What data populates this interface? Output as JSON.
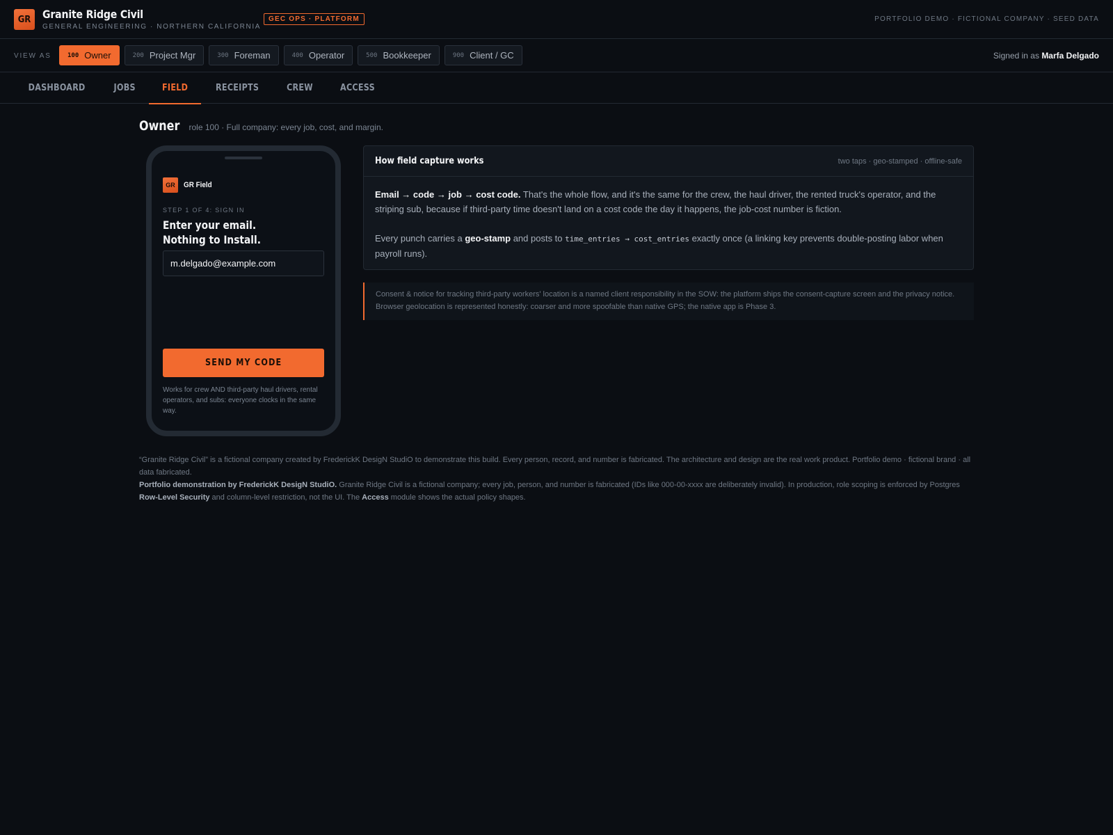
{
  "brand": {
    "logo": "GR",
    "name": "Granite Ridge Civil",
    "subtitle": "GENERAL ENGINEERING · NORTHERN CALIFORNIA",
    "badge": "GEC OPS · PLATFORM",
    "top_note": "PORTFOLIO DEMO · FICTIONAL COMPANY · SEED DATA"
  },
  "viewbar": {
    "label": "VIEW AS",
    "roles": [
      {
        "code": "100",
        "label": "Owner"
      },
      {
        "code": "200",
        "label": "Project Mgr"
      },
      {
        "code": "300",
        "label": "Foreman"
      },
      {
        "code": "400",
        "label": "Operator"
      },
      {
        "code": "500",
        "label": "Bookkeeper"
      },
      {
        "code": "900",
        "label": "Client / GC"
      }
    ],
    "signed_in_prefix": "Signed in as",
    "signed_in_user": "Marfa Delgado"
  },
  "nav": {
    "tabs": [
      "DASHBOARD",
      "JOBS",
      "FIELD",
      "RECEIPTS",
      "CREW",
      "ACCESS"
    ],
    "active": "FIELD"
  },
  "role_heading": {
    "title": "Owner",
    "desc": "role 100 · Full company: every job, cost, and margin."
  },
  "phone": {
    "logo": "GR",
    "app_name": "GR Field",
    "step": "STEP 1 OF 4: SIGN IN",
    "headline_1": "Enter your email.",
    "headline_2": "Nothing to Install.",
    "email_value": "m.delgado@example.com",
    "send_label": "SEND MY CODE",
    "note": "Works for crew AND third-party haul drivers, rental operators, and subs: everyone clocks in the same way."
  },
  "card": {
    "title": "How field capture works",
    "meta": "two taps · geo-stamped · offline-safe",
    "p1_bold": "Email → code → job → cost code.",
    "p1_rest": " That's the whole flow, and it's the same for the crew, the haul driver, the rented truck's operator, and the striping sub, because if third-party time doesn't land on a cost code the day it happens, the job-cost number is fiction.",
    "p2_a": "Every punch carries a ",
    "p2_bold": "geo-stamp",
    "p2_b": " and posts to ",
    "p2_code": "time_entries → cost_entries",
    "p2_c": " exactly once (a linking key prevents double-posting labor when payroll runs)."
  },
  "notice": {
    "text": "Consent & notice for tracking third-party workers' location is a named client responsibility in the SOW: the platform ships the consent-capture screen and the privacy notice. Browser geolocation is represented honestly: coarser and more spoofable than native GPS; the native app is Phase 3."
  },
  "footer": {
    "line1": "“Granite Ridge Civil” is a fictional company created by FrederickK DesigN StudiO to demonstrate this build. Every person, record, and number is fabricated. The architecture and design are the real work product. Portfolio demo · fictional brand · all data fabricated.",
    "l2_bold": "Portfolio demonstration by FrederickK DesigN StudiO.",
    "l2_a": " Granite Ridge Civil is a fictional company; every job, person, and number is fabricated (IDs like 000-00-xxxx are deliberately invalid). In production, role scoping is enforced by Postgres ",
    "l2_bold2": "Row-Level Security",
    "l2_b": " and column-level restriction, not the UI. The ",
    "l2_bold3": "Access",
    "l2_c": " module shows the actual policy shapes."
  },
  "colors": {
    "accent": "#f26a2f",
    "background": "#0b0e13",
    "card": "#12171e",
    "border": "#232a33"
  }
}
